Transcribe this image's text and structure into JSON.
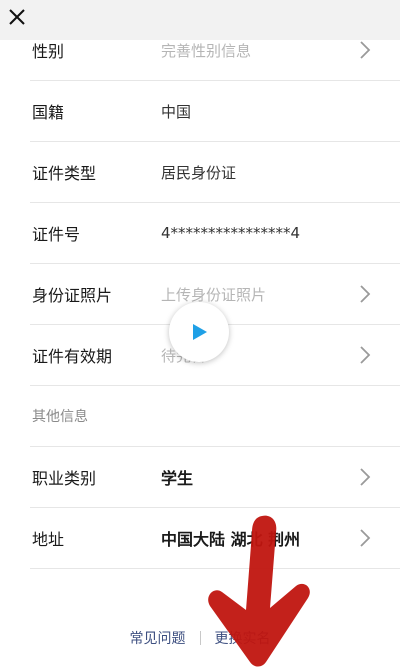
{
  "header": {
    "close_icon": "close-icon"
  },
  "rows": [
    {
      "label": "性别",
      "value": "完善性别信息",
      "style": "placeholder",
      "chevron": true
    },
    {
      "label": "国籍",
      "value": "中国",
      "style": "normal",
      "chevron": false
    },
    {
      "label": "证件类型",
      "value": "居民身份证",
      "style": "normal",
      "chevron": false
    },
    {
      "label": "证件号",
      "value": "4****************4",
      "style": "normal",
      "chevron": false
    },
    {
      "label": "身份证照片",
      "value": "上传身份证照片",
      "style": "placeholder",
      "chevron": true
    },
    {
      "label": "证件有效期",
      "value": "待完善",
      "style": "placeholder",
      "chevron": true
    }
  ],
  "other_section": {
    "title": "其他信息",
    "rows": [
      {
        "label": "职业类别",
        "value": "学生",
        "style": "bold",
        "chevron": true
      },
      {
        "label": "地址",
        "value": "中国大陆 湖北 荆州",
        "style": "bold",
        "chevron": true
      }
    ]
  },
  "footer": {
    "faq_label": "常见问题",
    "change_name_label": "更换实名"
  },
  "colors": {
    "link": "#3d4f80",
    "arrow": "#c0150f",
    "play": "#1fa0e6"
  }
}
